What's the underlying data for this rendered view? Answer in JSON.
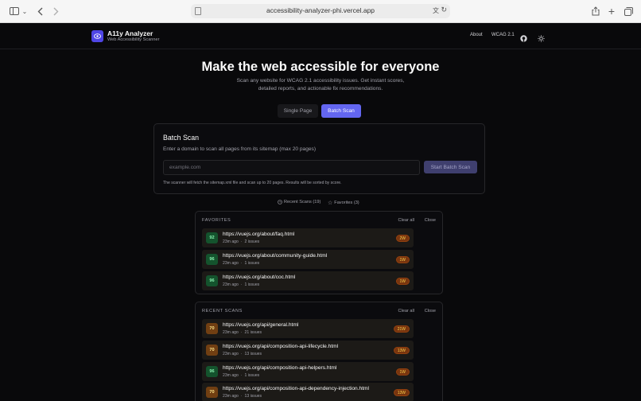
{
  "browser": {
    "url": "accessibility-analyzer-phi.vercel.app"
  },
  "header": {
    "brand_title": "A11y Analyzer",
    "brand_subtitle": "Web Accessibility Scanner",
    "nav_about": "About",
    "nav_wcag": "WCAG 2.1"
  },
  "hero": {
    "title": "Make the web accessible for everyone",
    "description": "Scan any website for WCAG 2.1 accessibility issues. Get instant scores, detailed reports, and actionable fix recommendations."
  },
  "tabs": {
    "single": "Single Page",
    "batch": "Batch Scan"
  },
  "batch": {
    "title": "Batch Scan",
    "description": "Enter a domain to scan all pages from its sitemap (max 20 pages)",
    "placeholder": "example.com",
    "button": "Start Batch Scan",
    "note": "The scanner will fetch the sitemap.xml file and scan up to 20 pages. Results will be sorted by score."
  },
  "toggles": {
    "recent": "Recent Scans (19)",
    "favorites": "Favorites (3)"
  },
  "favorites": {
    "heading": "FAVORITES",
    "clear": "Clear all",
    "close": "Close",
    "items": [
      {
        "score": "92",
        "url": "https://vuejs.org/about/faq.html",
        "time": "23m ago",
        "issues": "2 issues",
        "badge": "2W"
      },
      {
        "score": "96",
        "url": "https://vuejs.org/about/community-guide.html",
        "time": "23m ago",
        "issues": "1 issues",
        "badge": "1W"
      },
      {
        "score": "96",
        "url": "https://vuejs.org/about/coc.html",
        "time": "23m ago",
        "issues": "1 issues",
        "badge": "1W"
      }
    ]
  },
  "recent": {
    "heading": "RECENT SCANS",
    "clear": "Clear all",
    "close": "Close",
    "items": [
      {
        "score": "70",
        "url": "https://vuejs.org/api/general.html",
        "time": "23m ago",
        "issues": "21 issues",
        "badge": "21W"
      },
      {
        "score": "70",
        "url": "https://vuejs.org/api/composition-api-lifecycle.html",
        "time": "23m ago",
        "issues": "13 issues",
        "badge": "13W"
      },
      {
        "score": "96",
        "url": "https://vuejs.org/api/composition-api-helpers.html",
        "time": "23m ago",
        "issues": "1 issues",
        "badge": "1W"
      },
      {
        "score": "70",
        "url": "https://vuejs.org/api/composition-api-dependency-injection.html",
        "time": "23m ago",
        "issues": "13 issues",
        "badge": "13W"
      }
    ]
  },
  "colors": {
    "accent": "#6366f1",
    "good_score": "#14532d",
    "warn_score": "#713f12",
    "badge": "#78350f"
  }
}
